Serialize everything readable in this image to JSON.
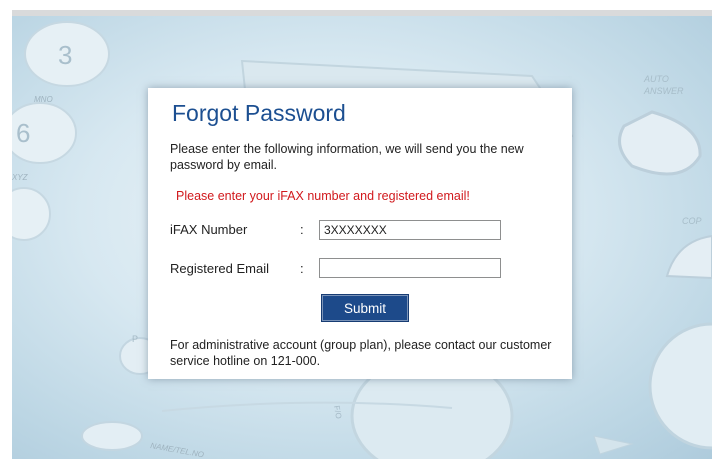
{
  "dialog": {
    "title": "Forgot Password",
    "intro": "Please enter the following information, we will send you the new password by email.",
    "warning": "Please enter your iFAX number and registered email!",
    "fax_label": "iFAX Number",
    "fax_colon": ":",
    "fax_value": "3XXXXXXX",
    "email_label": "Registered Email",
    "email_colon": ":",
    "email_value": "",
    "submit_label": "Submit",
    "admin_note": "For administrative account (group plan), please contact our customer service hotline on 121-000."
  },
  "background": {
    "key_3": "3",
    "key_6": "6",
    "key_mno": "MNO",
    "key_xyz": "XYZ",
    "auto_answer_1": "AUTO",
    "auto_answer_2": "ANSWER",
    "copy_key": "COP",
    "name_tel_no": "NAME/TEL.NO",
    "fo_label": "F/O",
    "p_label": "P"
  },
  "colors": {
    "title": "#1c4f91",
    "warning": "#d1191d",
    "submit_bg": "#1d4a8a",
    "backdrop": "#d7e8f1"
  }
}
